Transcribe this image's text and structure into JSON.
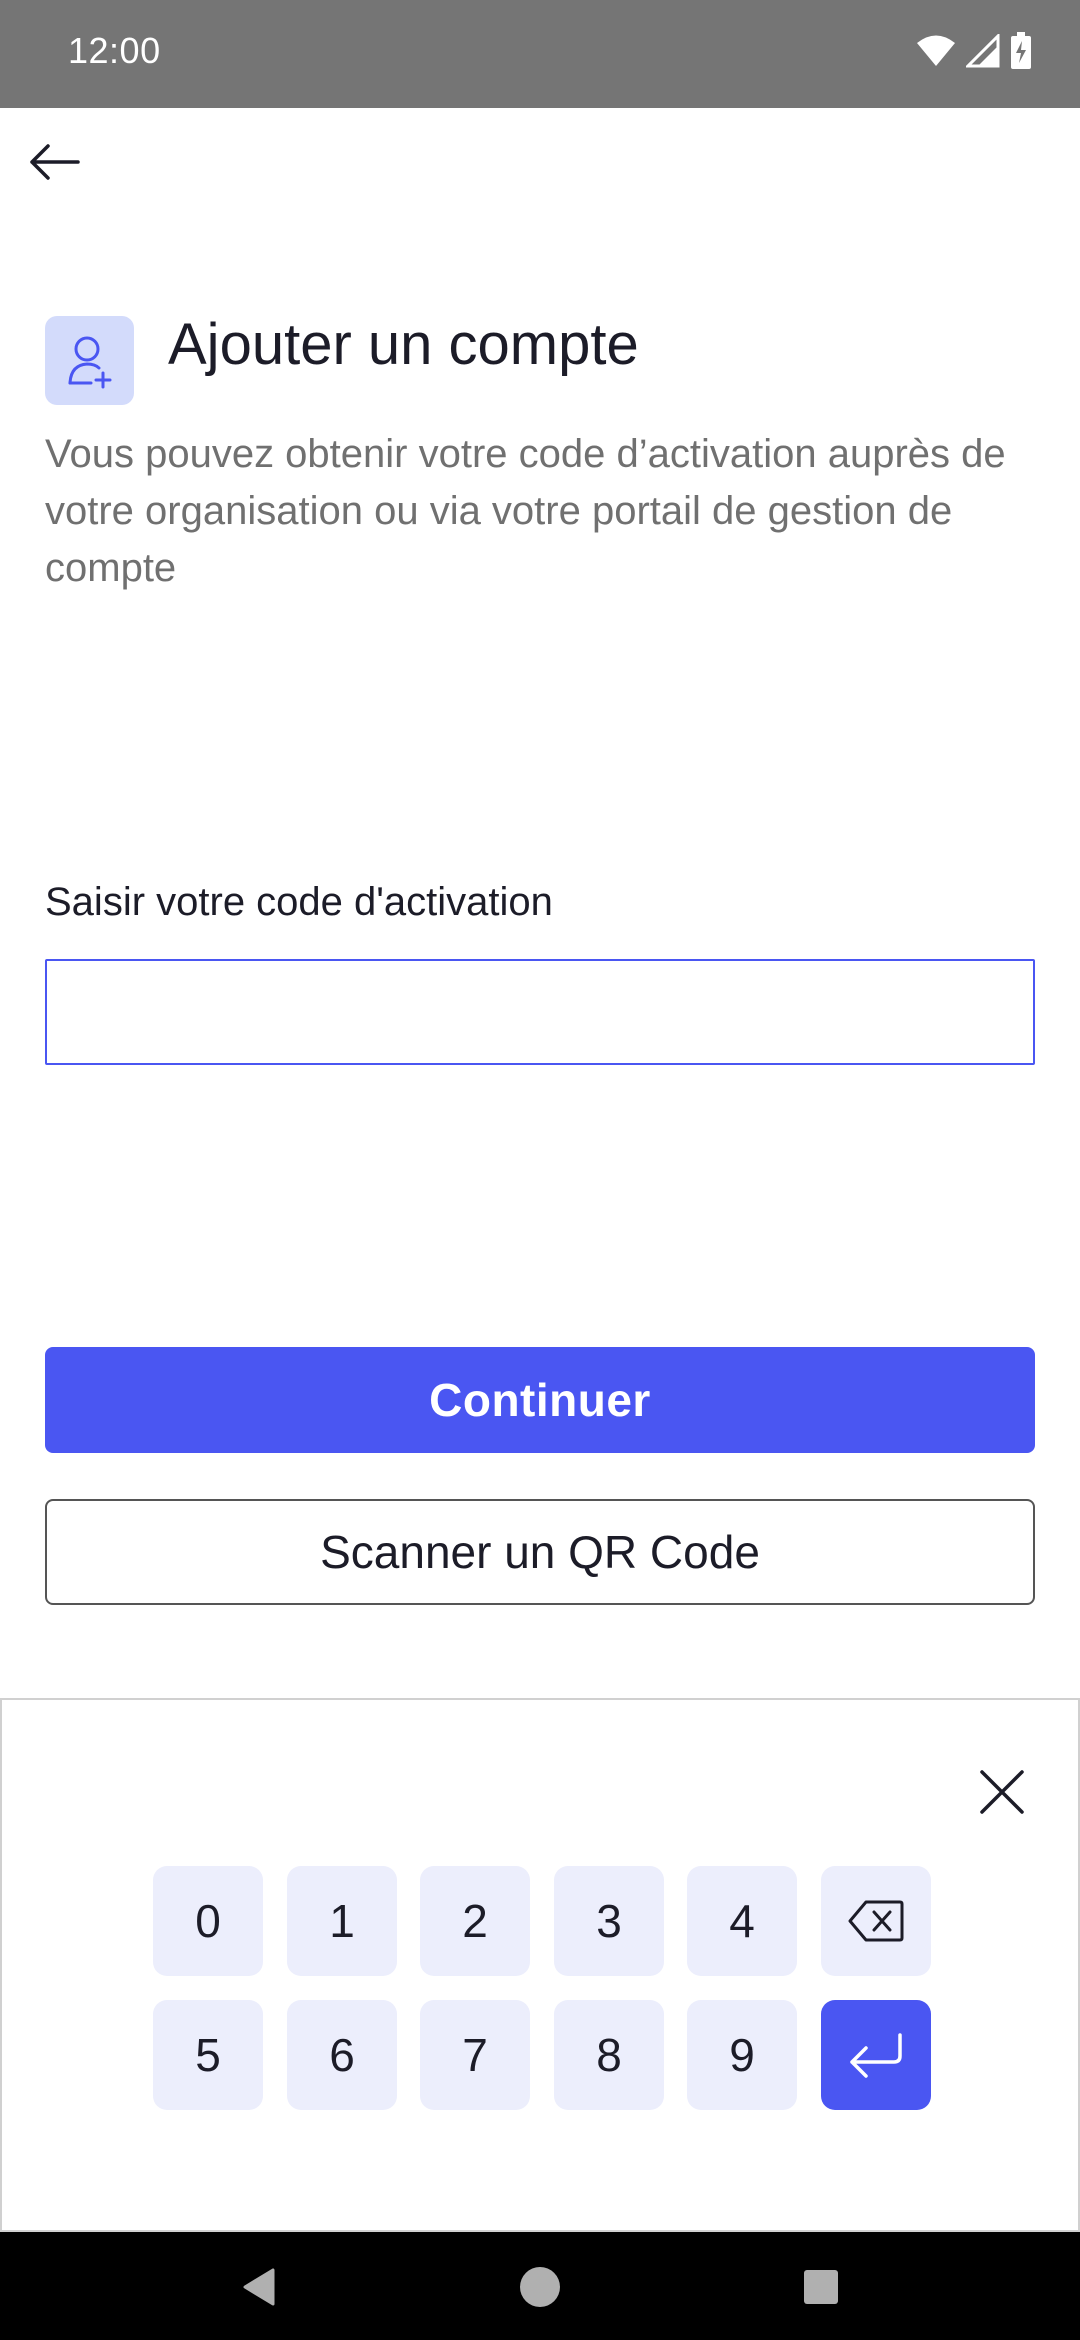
{
  "status_bar": {
    "time": "12:00"
  },
  "header": {
    "title": "Ajouter un compte"
  },
  "description": "Vous pouvez obtenir votre code d’activation auprès de votre organisation ou via votre portail de gestion de compte",
  "form": {
    "label": "Saisir votre code d'activation",
    "value": "",
    "placeholder": ""
  },
  "actions": {
    "continue_label": "Continuer",
    "scan_label": "Scanner un QR Code"
  },
  "keypad": {
    "row1": [
      "0",
      "1",
      "2",
      "3",
      "4"
    ],
    "row2": [
      "5",
      "6",
      "7",
      "8",
      "9"
    ]
  },
  "colors": {
    "accent": "#4a56f2",
    "icon_bg": "#d3dbfb",
    "key_bg": "#eceefc"
  }
}
